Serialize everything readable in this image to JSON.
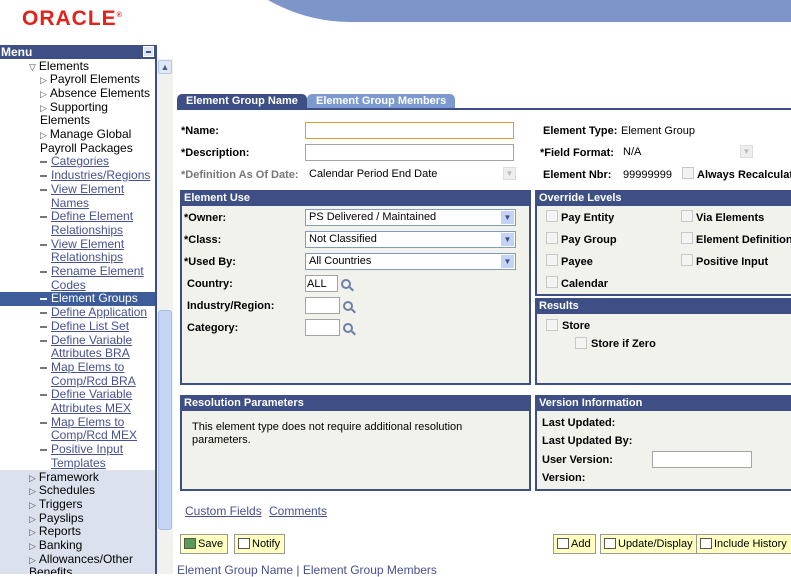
{
  "brand": {
    "logo": "ORACLE",
    "color": "#e2231a"
  },
  "menu": {
    "title": "Menu",
    "items": [
      {
        "label": "Elements",
        "type": "folder-open"
      },
      {
        "label": "Payroll Elements",
        "type": "folder"
      },
      {
        "label": "Absence Elements",
        "type": "folder"
      },
      {
        "label": "Supporting",
        "label2": "Elements",
        "type": "folder"
      },
      {
        "label": "Manage Global",
        "label2": "Payroll Packages",
        "type": "folder"
      },
      {
        "label": "Categories",
        "type": "link"
      },
      {
        "label": "Industries/Regions",
        "type": "link"
      },
      {
        "label": "View Element",
        "label2": "Names",
        "type": "link"
      },
      {
        "label": "Define Element",
        "label2": "Relationships",
        "type": "link"
      },
      {
        "label": "View Element",
        "label2": "Relationships",
        "type": "link"
      },
      {
        "label": "Rename Element",
        "label2": "Codes",
        "type": "link"
      },
      {
        "label": "Element Groups",
        "type": "selected"
      },
      {
        "label": "Define Application",
        "type": "link"
      },
      {
        "label": "Define List Set",
        "type": "link"
      },
      {
        "label": "Define Variable",
        "label2": "Attributes BRA",
        "type": "link"
      },
      {
        "label": "Map Elems to",
        "label2": "Comp/Rcd BRA",
        "type": "link"
      },
      {
        "label": "Define Variable",
        "label2": "Attributes MEX",
        "type": "link"
      },
      {
        "label": "Map Elems to",
        "label2": "Comp/Rcd MEX",
        "type": "link"
      },
      {
        "label": "Positive Input",
        "label2": "Templates",
        "type": "link"
      },
      {
        "label": "Framework",
        "type": "lower"
      },
      {
        "label": "Schedules",
        "type": "lower"
      },
      {
        "label": "Triggers",
        "type": "lower"
      },
      {
        "label": "Payslips",
        "type": "lower"
      },
      {
        "label": "Reports",
        "type": "lower"
      },
      {
        "label": "Banking",
        "type": "lower"
      },
      {
        "label": "Allowances/Other",
        "type": "lower"
      },
      {
        "label": "Benefits",
        "type": "lower-top"
      }
    ]
  },
  "tabs": [
    {
      "label": "Element Group Name",
      "active": true
    },
    {
      "label": "Element Group Members",
      "active": false
    }
  ],
  "form": {
    "name_label": "*Name:",
    "name_value": "",
    "description_label": "*Description:",
    "description_value": "",
    "def_date_label": "*Definition As Of Date:",
    "def_date_value": "Calendar Period End Date",
    "element_type_label": "Element Type:",
    "element_type_value": "Element Group",
    "field_format_label": "*Field Format:",
    "field_format_value": "N/A",
    "element_nbr_label": "Element Nbr:",
    "element_nbr_value": "99999999",
    "always_recalc_label": "Always Recalculat"
  },
  "element_use": {
    "title": "Element Use",
    "owner_label": "*Owner:",
    "owner_value": "PS Delivered / Maintained",
    "class_label": "*Class:",
    "class_value": "Not Classified",
    "used_by_label": "*Used By:",
    "used_by_value": "All Countries",
    "country_label": "Country:",
    "country_value": "ALL",
    "industry_label": "Industry/Region:",
    "industry_value": "",
    "category_label": "Category:",
    "category_value": ""
  },
  "override": {
    "title": "Override Levels",
    "items": [
      "Pay Entity",
      "Via Elements",
      "Pay Group",
      "Element Definition",
      "Payee",
      "Positive Input",
      "Calendar"
    ]
  },
  "results": {
    "title": "Results",
    "store": "Store",
    "store_if_zero": "Store if Zero"
  },
  "resolution": {
    "title": "Resolution Parameters",
    "text": "This element type does not require additional resolution parameters."
  },
  "version": {
    "title": "Version Information",
    "last_updated": "Last Updated:",
    "last_updated_by": "Last Updated By:",
    "user_version": "User Version:",
    "user_version_value": "",
    "version": "Version:"
  },
  "links": {
    "custom_fields": "Custom Fields",
    "comments": "Comments"
  },
  "buttons": {
    "save": "Save",
    "notify": "Notify",
    "add": "Add",
    "update": "Update/Display",
    "history": "Include History"
  },
  "footer": {
    "tab1": "Element Group Name",
    "sep": " | ",
    "tab2": "Element Group Members"
  }
}
